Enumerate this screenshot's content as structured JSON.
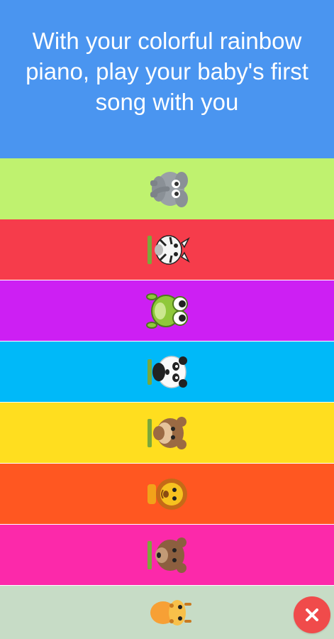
{
  "banner": {
    "text": "With your colorful rainbow piano, play your baby's first song with you",
    "background": "#4a95f0"
  },
  "keys": [
    {
      "color": "#bff26f",
      "animal": "elephant-icon"
    },
    {
      "color": "#f63c4b",
      "animal": "zebra-icon"
    },
    {
      "color": "#cd1ff3",
      "animal": "frog-icon"
    },
    {
      "color": "#00b9f9",
      "animal": "panda-icon"
    },
    {
      "color": "#ffde1f",
      "animal": "monkey-icon"
    },
    {
      "color": "#ff5721",
      "animal": "lion-icon"
    },
    {
      "color": "#fc29aa",
      "animal": "bear-icon"
    },
    {
      "color": "#c7dcc6",
      "animal": "giraffe-icon"
    }
  ],
  "close_button": {
    "icon": "close-icon",
    "color": "#f04b4b"
  }
}
